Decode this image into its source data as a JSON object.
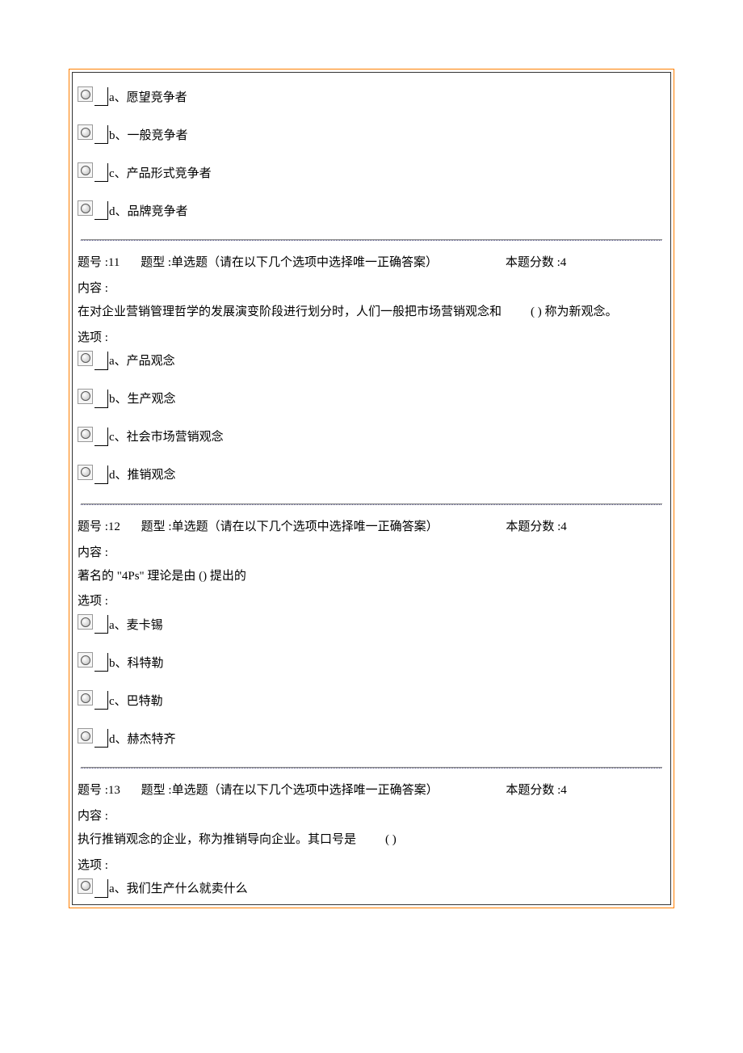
{
  "labels": {
    "qnum_prefix": "题号 :",
    "qtype_prefix": "题型 :",
    "score_prefix": "本题分数  :",
    "content_label": "内容 :",
    "options_label": "选项 :"
  },
  "q10_partial": {
    "options": [
      {
        "key": "a",
        "text": "a、愿望竞争者"
      },
      {
        "key": "b",
        "text": "b、一般竞争者"
      },
      {
        "key": "c",
        "text": "c、产品形式竞争者"
      },
      {
        "key": "d",
        "text": "d、品牌竞争者"
      }
    ]
  },
  "q11": {
    "number": "11",
    "qtype": "单选题（请在以下几个选项中选择唯一正确答案）",
    "score": "4",
    "content_pre": "在对企业营销管理哲学的发展演变阶段进行划分时，人们一般把市场营销观念和",
    "content_post": "( ) 称为新观念。",
    "options": [
      {
        "key": "a",
        "text": "a、产品观念"
      },
      {
        "key": "b",
        "text": "b、生产观念"
      },
      {
        "key": "c",
        "text": "c、社会市场营销观念"
      },
      {
        "key": "d",
        "text": "d、推销观念"
      }
    ]
  },
  "q12": {
    "number": "12",
    "qtype": "单选题（请在以下几个选项中选择唯一正确答案）",
    "score": "4",
    "content": "著名的 \"4Ps\" 理论是由  () 提出的",
    "options": [
      {
        "key": "a",
        "text": "a、麦卡锡"
      },
      {
        "key": "b",
        "text": "b、科特勒"
      },
      {
        "key": "c",
        "text": "c、巴特勒"
      },
      {
        "key": "d",
        "text": "d、赫杰特齐"
      }
    ]
  },
  "q13": {
    "number": "13",
    "qtype": "单选题（请在以下几个选项中选择唯一正确答案）",
    "score": "4",
    "content_pre": "执行推销观念的企业，称为推销导向企业。其口号是",
    "content_post": "( )",
    "options": [
      {
        "key": "a",
        "text": "a、我们生产什么就卖什么"
      }
    ]
  }
}
